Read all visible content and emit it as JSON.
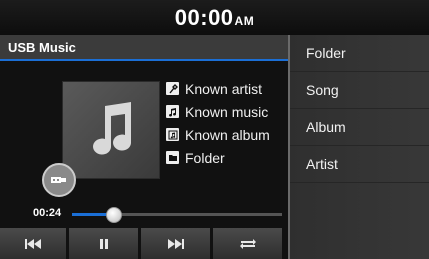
{
  "clock": {
    "time": "00:00",
    "ampm": "AM"
  },
  "header": {
    "title": "USB Music"
  },
  "track_info": [
    {
      "icon": "artist-icon",
      "text": "Known artist"
    },
    {
      "icon": "music-note-icon",
      "text": "Known music"
    },
    {
      "icon": "album-icon",
      "text": "Known album"
    },
    {
      "icon": "folder-icon",
      "text": "Folder"
    }
  ],
  "playback": {
    "elapsed": "00:24",
    "progress_fraction": 0.2
  },
  "controls": {
    "prev": "previous-track-icon",
    "pause": "pause-icon",
    "next": "next-track-icon",
    "repeat": "repeat-icon"
  },
  "menu": [
    "Folder",
    "Song",
    "Album",
    "Artist"
  ],
  "colors": {
    "accent": "#1b6fd6",
    "background": "#0a0a0a",
    "panel": "#333333"
  }
}
